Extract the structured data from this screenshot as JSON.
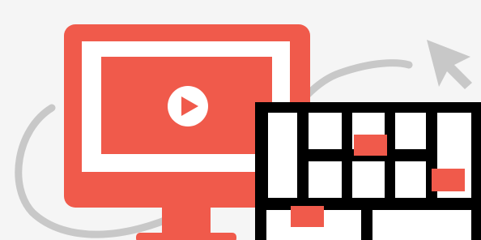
{
  "illustration": {
    "background_color": "#f5f5f5",
    "accent_color": "#f05a4b",
    "curve_color": "#c8c8c8",
    "cursor_color": "#c8c8c8",
    "frame_color": "#000000",
    "key_color": "#ffffff",
    "play_icon": "play-circle-icon",
    "cursor_icon": "arrow-cursor-icon"
  }
}
